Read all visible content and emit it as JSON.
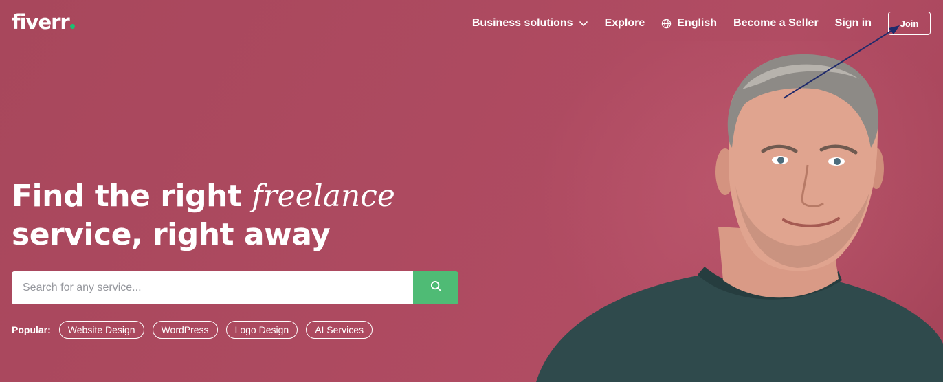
{
  "header": {
    "logo": "fiverr",
    "nav": {
      "business_solutions": "Business solutions",
      "explore": "Explore",
      "language": "English",
      "become_seller": "Become a Seller",
      "sign_in": "Sign in",
      "join": "Join"
    }
  },
  "hero": {
    "headline_part1": "Find the right ",
    "headline_italic": "freelance",
    "headline_part2": "service, right away"
  },
  "search": {
    "placeholder": "Search for any service..."
  },
  "popular": {
    "label": "Popular:",
    "chips": [
      "Website Design",
      "WordPress",
      "Logo Design",
      "AI Services"
    ]
  },
  "colors": {
    "background": "#ad4a60",
    "search_button": "#4fbb75",
    "logo_dot": "#1dbf73",
    "annotation_arrow": "#1f2a6b"
  },
  "icons": {
    "dropdown": "chevron-down-icon",
    "language": "globe-icon",
    "search": "search-icon"
  }
}
